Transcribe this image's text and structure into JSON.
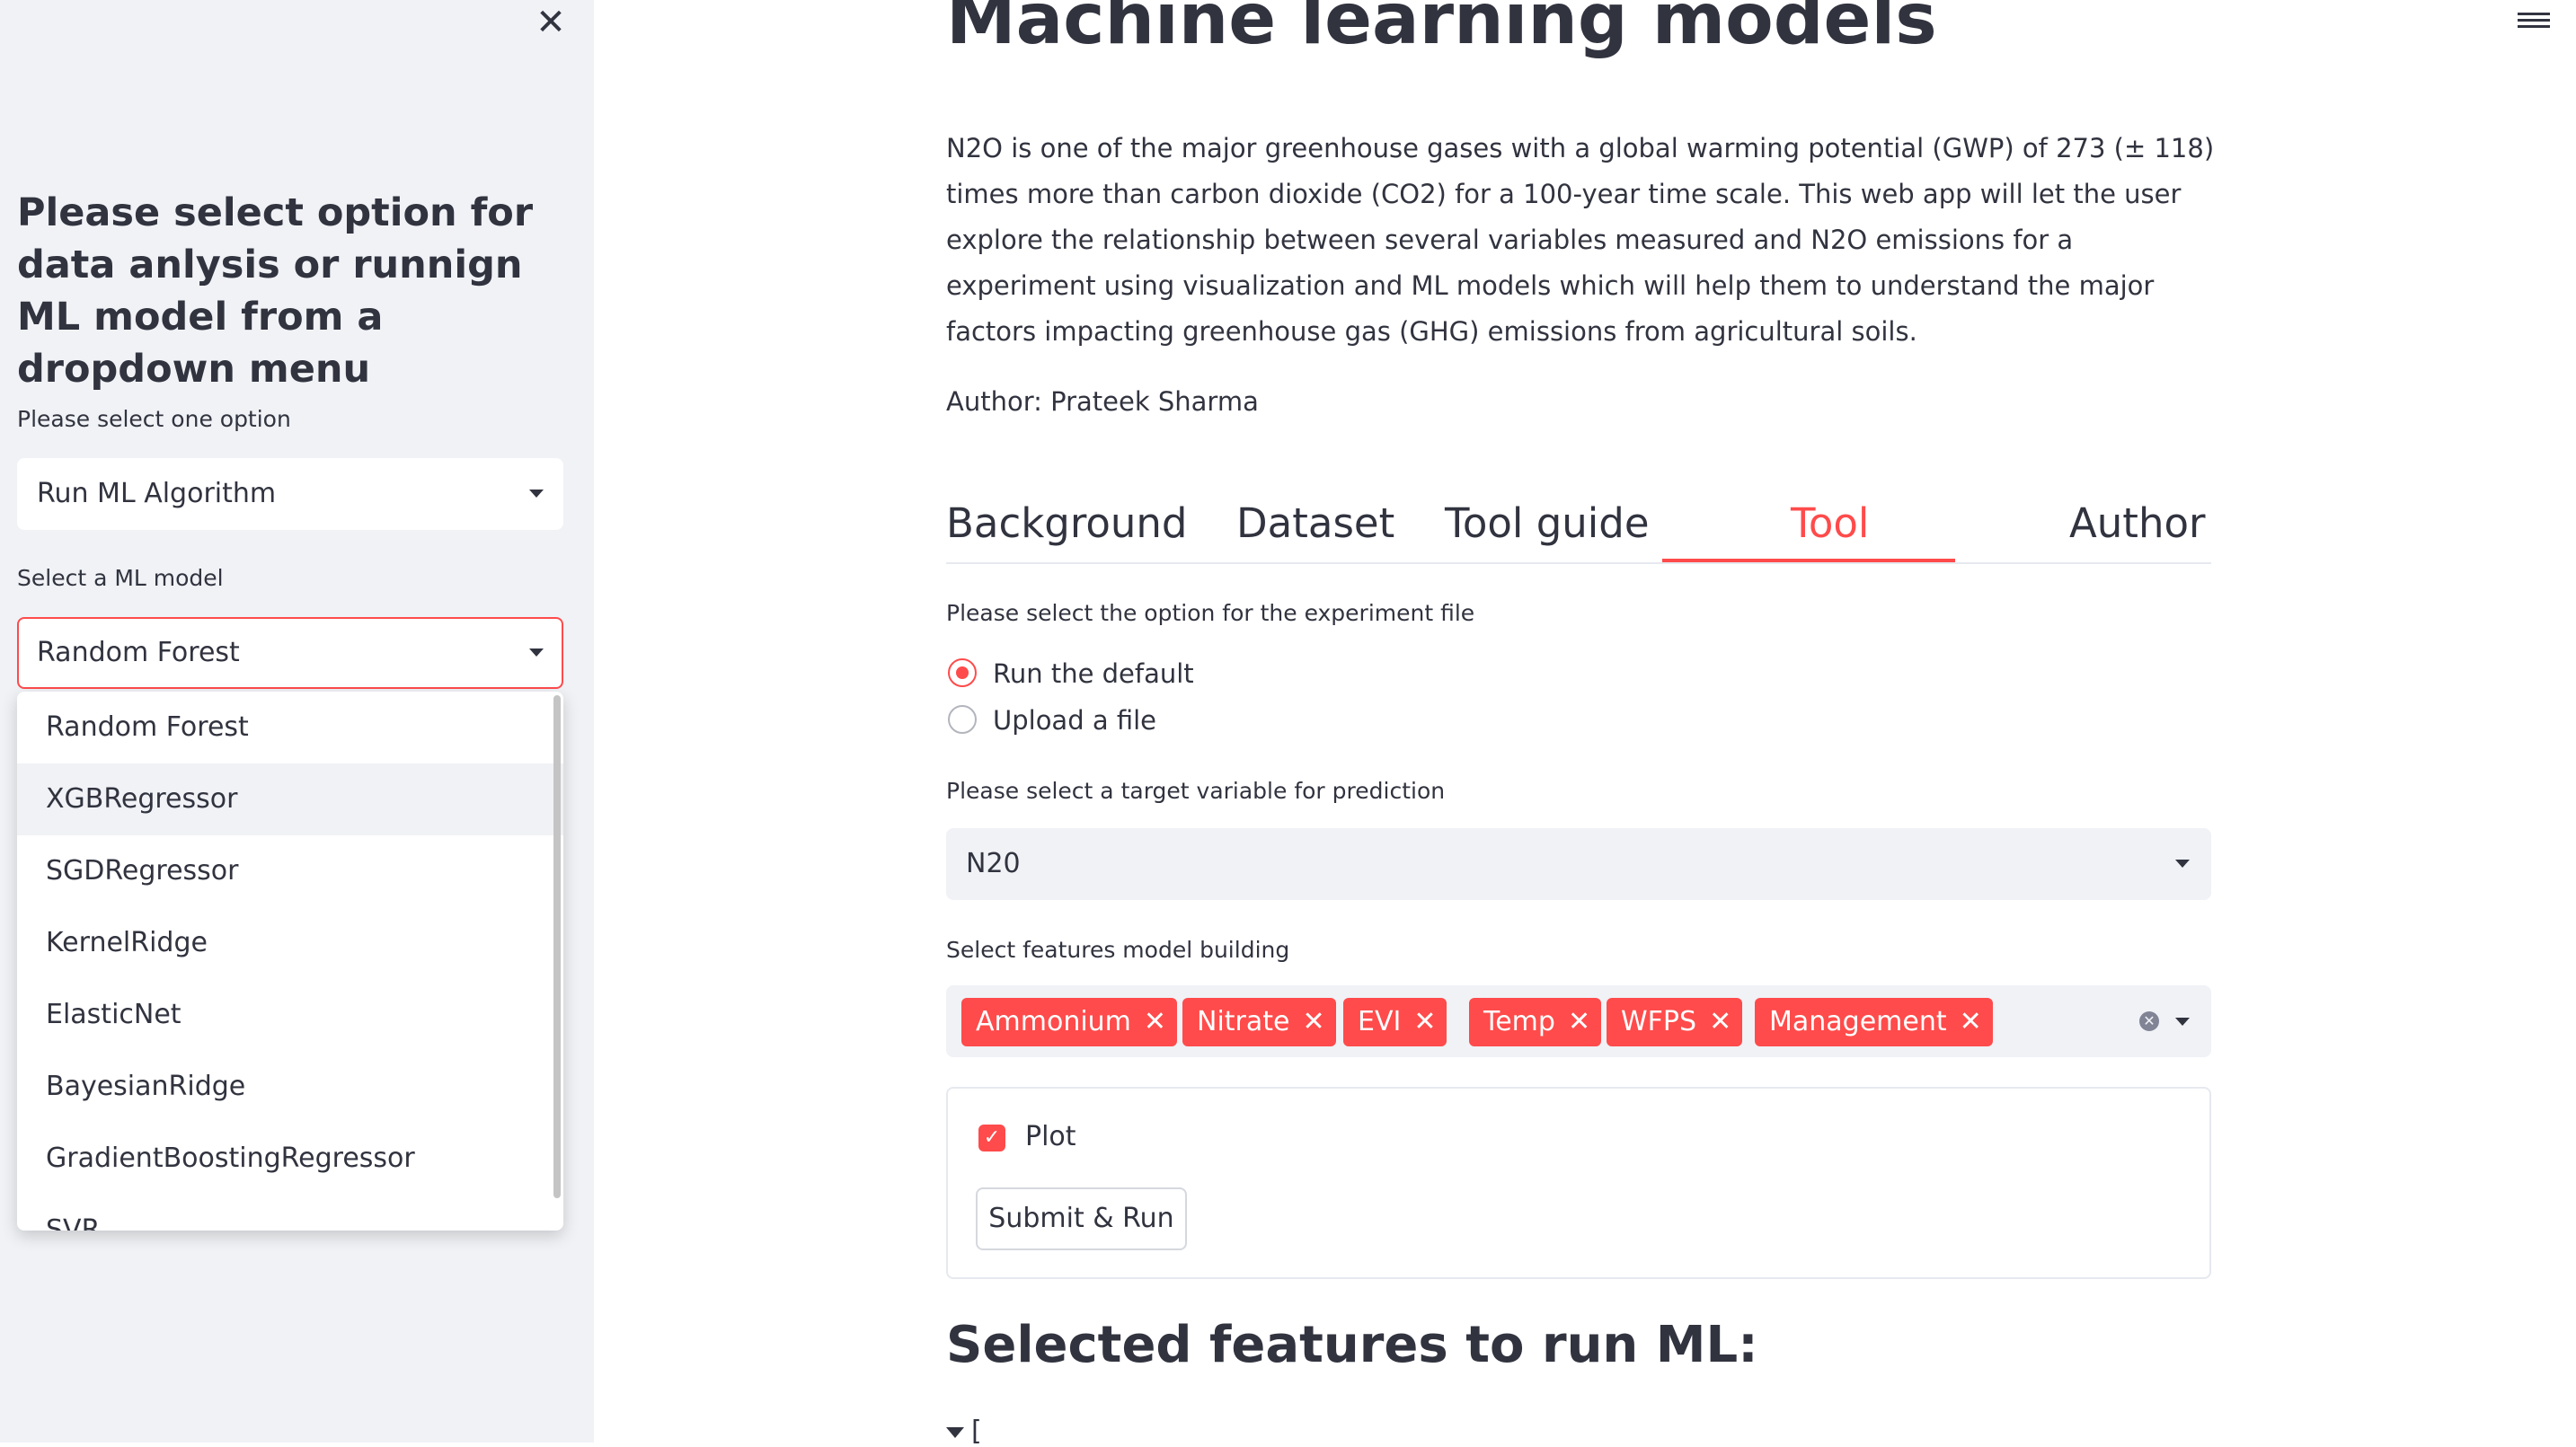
{
  "sidebar": {
    "close_icon": "close-icon",
    "heading": "Please select option for data anlysis or runnign ML model from a dropdown menu",
    "option_label": "Please select one option",
    "option_value": "Run ML Algorithm",
    "model_label": "Select a ML model",
    "model_value": "Random Forest",
    "model_options": [
      "Random Forest",
      "XGBRegressor",
      "SGDRegressor",
      "KernelRidge",
      "ElasticNet",
      "BayesianRidge",
      "GradientBoostingRegressor",
      "SVR"
    ],
    "hovered_option_index": 1
  },
  "main": {
    "title": "Machine learning models",
    "intro": "N2O is one of the major greenhouse gases with a global warming potential (GWP) of 273 (± 118) times more than carbon dioxide (CO2) for a 100-year time scale. This web app will let the user explore the relationship between several variables measured and N2O emissions for a experiment using visualization and ML models which will help them to understand the major factors impacting greenhouse gas (GHG) emissions from agricultural soils.",
    "author": "Author: Prateek Sharma",
    "tabs": [
      "Background",
      "Dataset",
      "Tool guide",
      "Tool",
      "Author"
    ],
    "active_tab": "Tool",
    "experiment_label": "Please select the option for the experiment file",
    "radio_options": [
      "Run the default",
      "Upload a file"
    ],
    "radio_selected": "Run the default",
    "target_label": "Please select a target variable for prediction",
    "target_value": "N20",
    "features_label": "Select features model building",
    "features": [
      "Ammonium",
      "Nitrate",
      "EVI",
      "Temp",
      "WFPS",
      "Management"
    ],
    "chip_remove_glyph": "✕",
    "plot_label": "Plot",
    "plot_checked": true,
    "submit_label": "Submit & Run",
    "selected_heading": "Selected features to run ML:",
    "expander_text": "["
  },
  "colors": {
    "accent": "#ff4b4b",
    "sidebar_bg": "#f0f2f6",
    "text": "#31333f"
  }
}
